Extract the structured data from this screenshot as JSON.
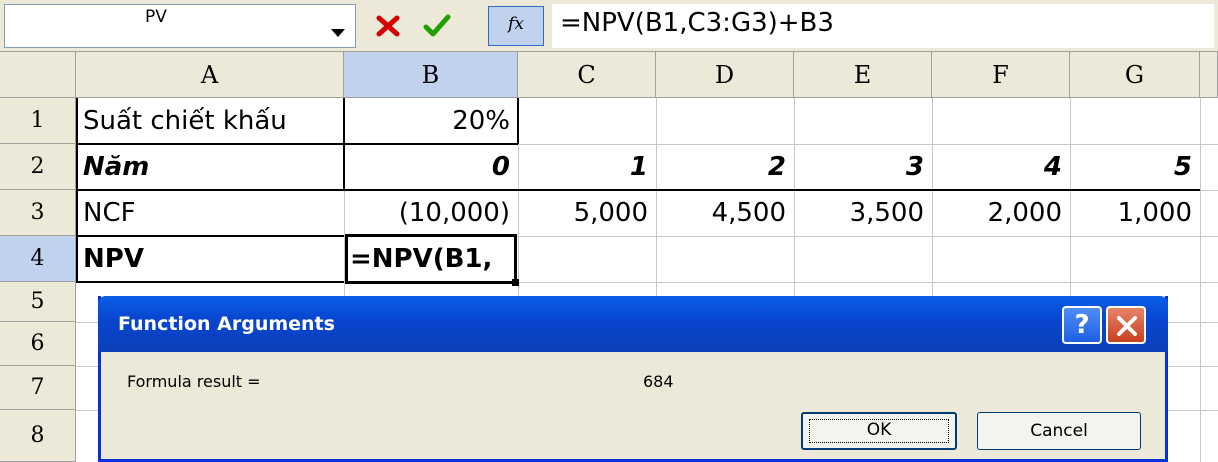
{
  "formula_bar": {
    "name_box": "PV",
    "fx_label": "fx",
    "formula": "=NPV(B1,C3:G3)+B3"
  },
  "columns": [
    "A",
    "B",
    "C",
    "D",
    "E",
    "F",
    "G"
  ],
  "rows": [
    "1",
    "2",
    "3",
    "4",
    "5",
    "6",
    "7",
    "8"
  ],
  "cells": {
    "A1": "Suất chiết khấu",
    "B1": "20%",
    "A2": "Năm",
    "B2": "0",
    "C2": "1",
    "D2": "2",
    "E2": "3",
    "F2": "4",
    "G2": "5",
    "A3": "NCF",
    "B3": "(10,000)",
    "C3": "5,000",
    "D3": "4,500",
    "E3": "3,500",
    "F3": "2,000",
    "G3": "1,000",
    "A4": "NPV",
    "B4": "=NPV(B1,"
  },
  "dialog": {
    "title": "Function Arguments",
    "help_label": "?",
    "result_label": "Formula result =",
    "result_value": "684",
    "ok_label": "OK",
    "cancel_label": "Cancel"
  },
  "colors": {
    "header_bg": "#ece9d8",
    "selected_header": "#c1d2ee",
    "dialog_title": "#0846d0",
    "close_red": "#c7401f"
  }
}
